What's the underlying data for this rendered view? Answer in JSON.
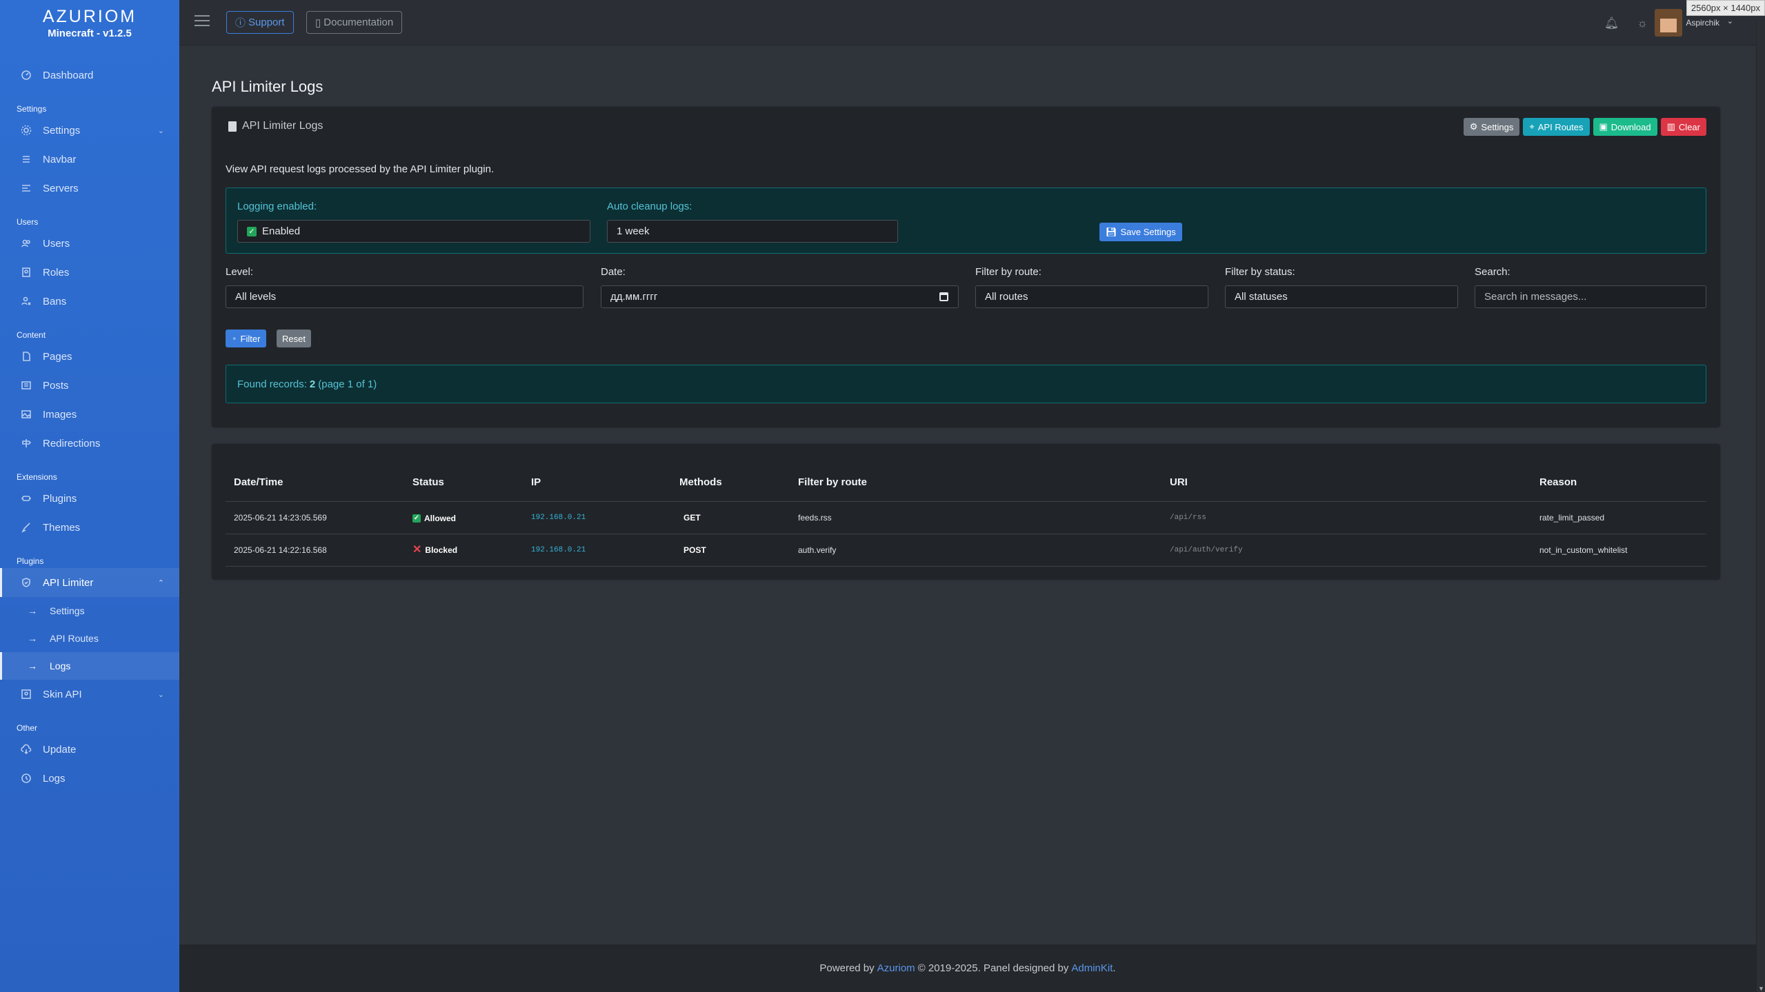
{
  "sidebar": {
    "brand": "AZURIOM",
    "version": "Minecraft - v1.2.5",
    "sections": [
      {
        "header": "",
        "items": [
          {
            "label": "Dashboard",
            "icon": "dashboard-icon"
          }
        ]
      },
      {
        "header": "Settings",
        "items": [
          {
            "label": "Settings",
            "icon": "gear-icon",
            "chevron": "⌄"
          },
          {
            "label": "Navbar",
            "icon": "list-icon"
          },
          {
            "label": "Servers",
            "icon": "server-icon"
          }
        ]
      },
      {
        "header": "Users",
        "items": [
          {
            "label": "Users",
            "icon": "users-icon"
          },
          {
            "label": "Roles",
            "icon": "roles-icon"
          },
          {
            "label": "Bans",
            "icon": "ban-icon"
          }
        ]
      },
      {
        "header": "Content",
        "items": [
          {
            "label": "Pages",
            "icon": "page-icon"
          },
          {
            "label": "Posts",
            "icon": "post-icon"
          },
          {
            "label": "Images",
            "icon": "image-icon"
          },
          {
            "label": "Redirections",
            "icon": "signpost-icon"
          }
        ]
      },
      {
        "header": "Extensions",
        "items": [
          {
            "label": "Plugins",
            "icon": "plugin-icon"
          },
          {
            "label": "Themes",
            "icon": "brush-icon"
          }
        ]
      },
      {
        "header": "Plugins",
        "items": [
          {
            "label": "API Limiter",
            "icon": "shield-icon",
            "chevron": "⌃",
            "active": true
          }
        ]
      },
      {
        "header": "Other",
        "items": [
          {
            "label": "Update",
            "icon": "cloud-download-icon"
          },
          {
            "label": "Logs",
            "icon": "clock-icon"
          }
        ]
      }
    ],
    "api_limiter_sub": [
      "Settings",
      "API Routes",
      "Logs"
    ],
    "skin_api": "Skin API"
  },
  "topbar": {
    "support": "Support",
    "documentation": "Documentation",
    "username": "Aspirchik",
    "size_badge": "2560px × 1440px"
  },
  "page": {
    "title": "API Limiter Logs",
    "card_title": "API Limiter Logs",
    "buttons": {
      "settings": "Settings",
      "api_routes": "API Routes",
      "download": "Download",
      "clear": "Clear"
    },
    "description": "View API request logs processed by the API Limiter plugin.",
    "logging_label": "Logging enabled:",
    "logging_value": "Enabled",
    "cleanup_label": "Auto cleanup logs:",
    "cleanup_value": "1 week",
    "save_settings": "Save Settings",
    "filters": {
      "level_label": "Level:",
      "level_value": "All levels",
      "date_label": "Date:",
      "date_placeholder": "дд.мм.гггг",
      "route_label": "Filter by route:",
      "route_value": "All routes",
      "status_label": "Filter by status:",
      "status_value": "All statuses",
      "search_label": "Search:",
      "search_placeholder": "Search in messages..."
    },
    "filter_button": "Filter",
    "reset_button": "Reset",
    "found_prefix": "Found records:",
    "found_count": "2",
    "found_suffix": "(page 1 of 1)"
  },
  "table": {
    "headers": [
      "Date/Time",
      "Status",
      "IP",
      "Methods",
      "Filter by route",
      "URI",
      "Reason"
    ],
    "rows": [
      {
        "datetime": "2025-06-21 14:23:05.569",
        "status": "Allowed",
        "ip": "192.168.0.21",
        "method": "GET",
        "route": "feeds.rss",
        "uri": "/api/rss",
        "reason": "rate_limit_passed"
      },
      {
        "datetime": "2025-06-21 14:22:16.568",
        "status": "Blocked",
        "ip": "192.168.0.21",
        "method": "POST",
        "route": "auth.verify",
        "uri": "/api/auth/verify",
        "reason": "not_in_custom_whitelist"
      }
    ]
  },
  "footer": {
    "powered": "Powered by",
    "azuriom": "Azuriom",
    "middle": "© 2019-2025. Panel designed by",
    "adminkit": "AdminKit",
    "end": "."
  },
  "colors": {
    "sidebar": "#2f6fd3",
    "primary": "#3b7ddd",
    "teal": "#17a2b8",
    "green": "#1cbb8c",
    "red": "#dc3545"
  }
}
